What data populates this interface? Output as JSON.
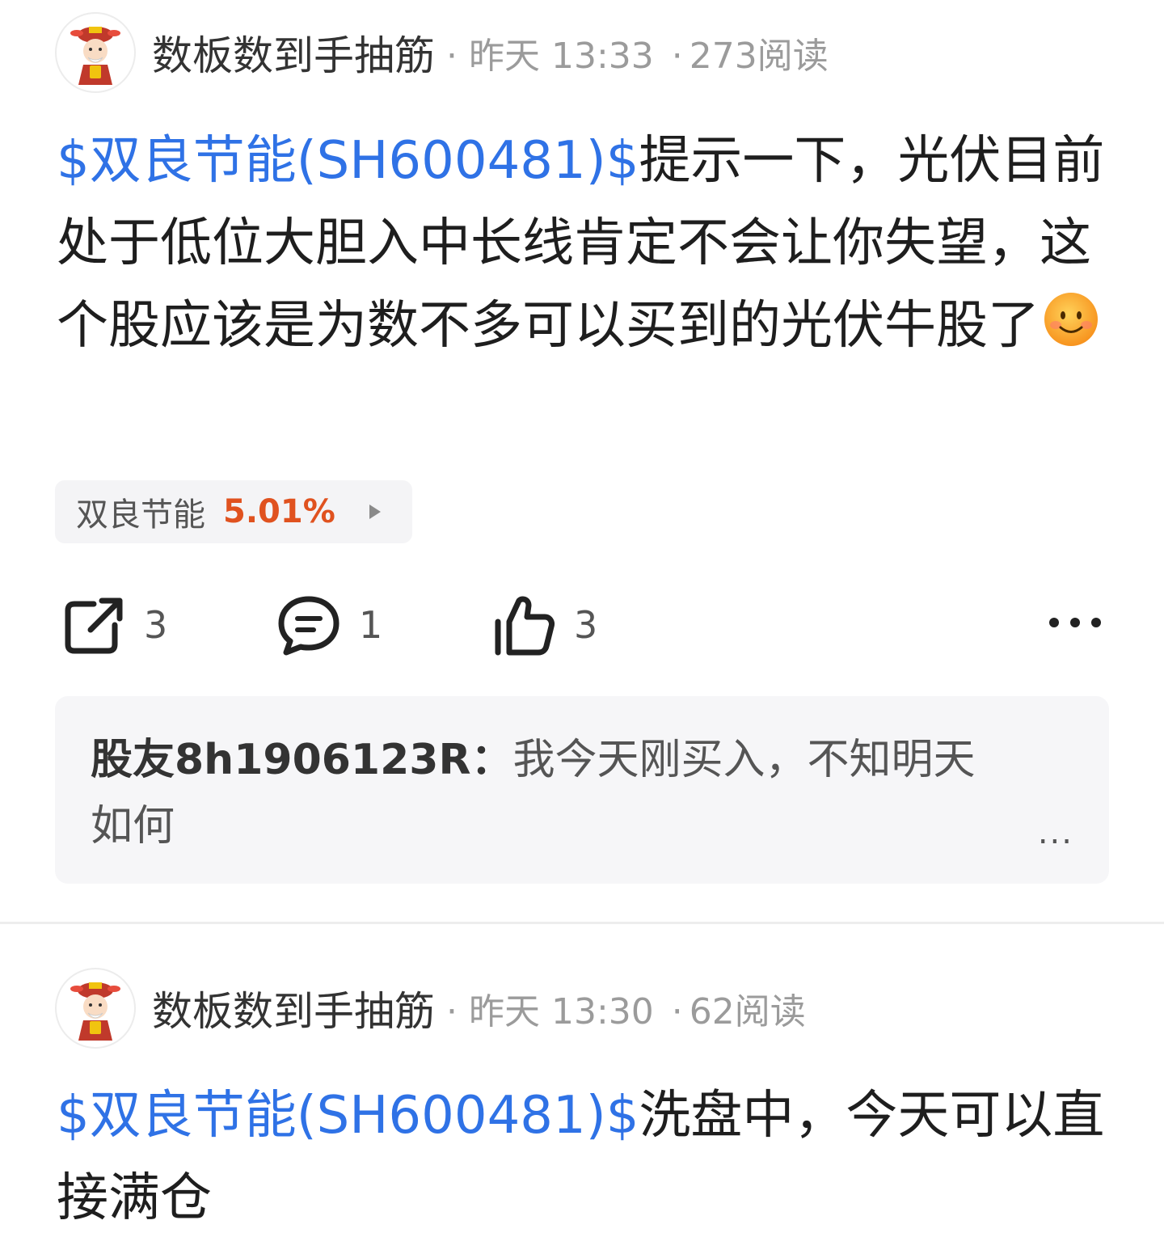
{
  "posts": [
    {
      "author": "数板数到手抽筋",
      "meta_sep": "·",
      "time": "昨天 13:33",
      "reads": "273阅读",
      "stock_tag": "$双良节能(SH600481)$",
      "text": "提示一下，光伏目前处于低位大胆入中长线肯定不会让你失望，这个股应该是为数不多可以买到的光伏牛股了",
      "emoji": "smile-emoji",
      "stock_chip": {
        "name": "双良节能",
        "change": "5.01%"
      },
      "actions": {
        "share_count": "3",
        "comment_count": "1",
        "like_count": "3"
      },
      "comment_preview": {
        "user": "股友8h1906123R：",
        "text": "我今天刚买入，不知明天如何",
        "more": "..."
      }
    },
    {
      "author": "数板数到手抽筋",
      "meta_sep": "·",
      "time": "昨天 13:30",
      "reads": "62阅读",
      "stock_tag": "$双良节能(SH600481)$",
      "text": "洗盘中，今天可以直接满仓"
    }
  ],
  "colors": {
    "link": "#2f72e6",
    "up_change": "#e0521f",
    "meta": "#9b9b9b"
  }
}
